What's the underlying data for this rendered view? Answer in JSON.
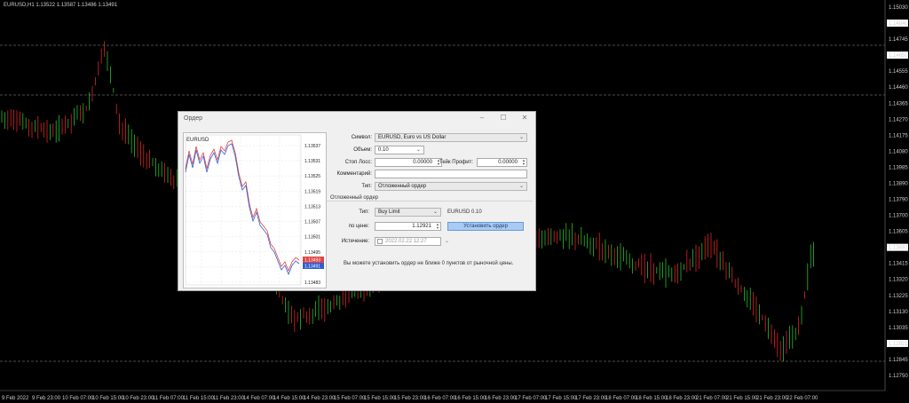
{
  "chart": {
    "symbol_header": "EURUSD,H1  1.13522 1.13587 1.13486 1.13491",
    "price_labels": [
      "1.15030",
      "1.14840",
      "1.14745",
      "1.14650",
      "1.14555",
      "1.14460",
      "1.14365",
      "1.14270",
      "1.14175",
      "1.14080",
      "1.13985",
      "1.13890",
      "1.13790",
      "1.13700",
      "1.13605",
      "1.13491",
      "1.13415",
      "1.13320",
      "1.13225",
      "1.13130",
      "1.13035",
      "1.12921",
      "1.12845",
      "1.12750"
    ],
    "highlight_prices": [
      "1.14840",
      "1.14650",
      "1.13491",
      "1.12921"
    ],
    "time_labels": [
      "9 Feb 2022",
      "9 Feb 23:00",
      "10 Feb 07:00",
      "10 Feb 15:00",
      "10 Feb 23:00",
      "11 Feb 07:00",
      "11 Feb 15:00",
      "11 Feb 23:00",
      "14 Feb 07:00",
      "14 Feb 15:00",
      "14 Feb 23:00",
      "15 Feb 07:00",
      "15 Feb 15:00",
      "15 Feb 23:00",
      "16 Feb 07:00",
      "16 Feb 15:00",
      "16 Feb 23:00",
      "17 Feb 07:00",
      "17 Feb 15:00",
      "17 Feb 23:00",
      "18 Feb 07:00",
      "18 Feb 15:00",
      "18 Feb 23:00",
      "21 Feb 07:00",
      "21 Feb 15:00",
      "21 Feb 23:00",
      "22 Feb 07:00"
    ],
    "colors": {
      "bull": "#22c02a",
      "bear": "#e02424",
      "grid": "#9a9a9a",
      "axis_text": "#cfcfcf",
      "bid_box": "#ffffff"
    }
  },
  "dialog": {
    "title": "Ордер",
    "controls": [
      "–",
      "☐",
      "✕"
    ],
    "mini_chart": {
      "symbol": "EURUSD",
      "price_labels": [
        "1.13537",
        "1.13531",
        "1.13525",
        "1.13519",
        "1.13513",
        "1.13507",
        "1.13501",
        "1.13495",
        "1.13489",
        "1.13483"
      ],
      "ask_label": "1.13493",
      "bid_label": "1.13491",
      "ask_color": "#e04545",
      "bid_color": "#2d5fd6"
    },
    "symbol_label": "Символ:",
    "symbol_value": "EURUSD, Euro vs US Dollar",
    "volume_label": "Объем:",
    "volume_value": "0.10",
    "sl_label": "Стоп Лосс:",
    "sl_value": "0.00000",
    "tp_label": "Тейк Профит:",
    "tp_value": "0.00000",
    "comment_label": "Комментарий:",
    "comment_value": "",
    "type_label": "Тип:",
    "type_value": "Отложенный ордер",
    "pending_title": "Отложенный ордер",
    "pending_type_label": "Тип:",
    "pending_type_value": "Buy Limit",
    "pending_symbol_info": "EURUSD 0.10",
    "price_label": "по цене:",
    "price_value": "1.12921",
    "place_button": "Установить ордер",
    "expiry_label": "Истечение:",
    "expiry_value": "2022.02.22 12:27",
    "note": "Вы можете установить ордер не ближе 0 пунктов от рыночной цены."
  }
}
